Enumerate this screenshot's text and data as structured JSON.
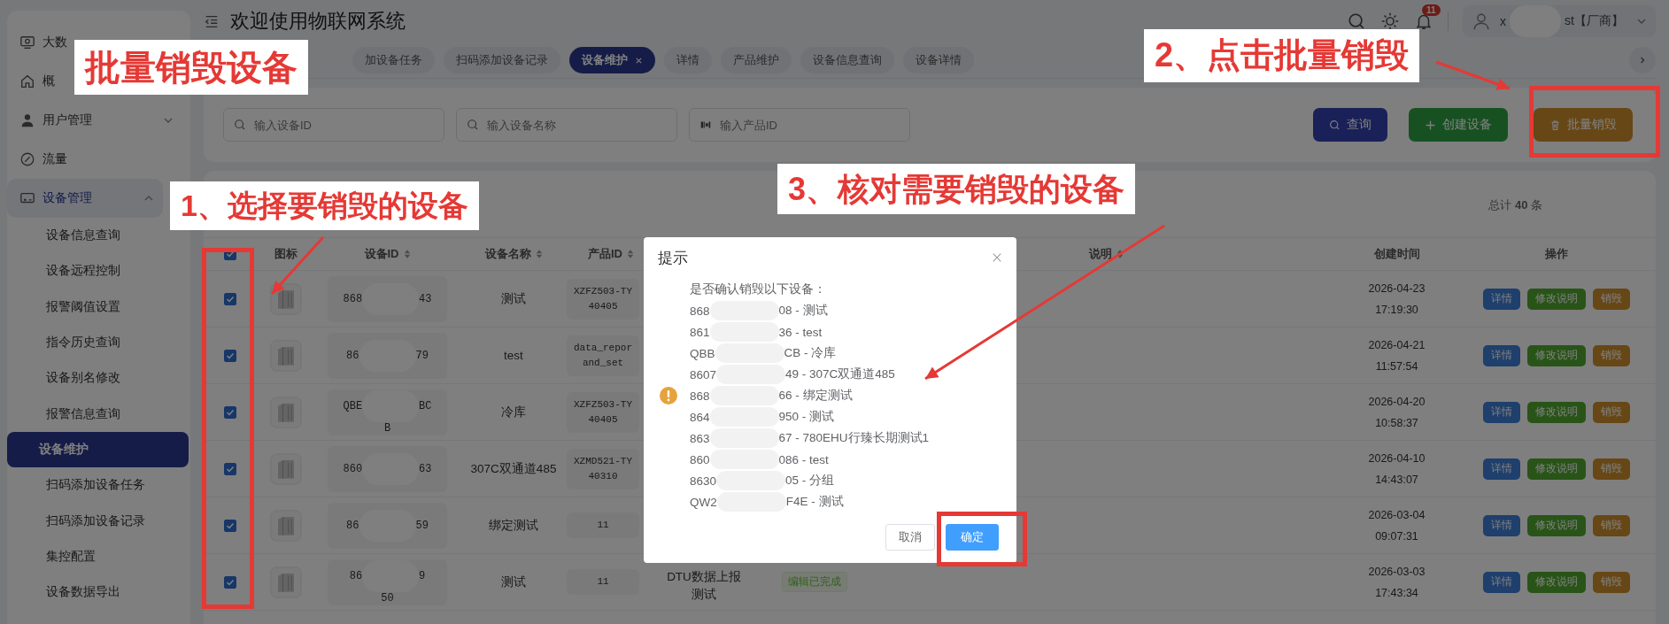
{
  "annotations": {
    "callouts": [
      {
        "text": "批量销毁设备"
      },
      {
        "text": "1、选择要销毁的设备"
      },
      {
        "text": "2、点击批量销毁"
      },
      {
        "text": "3、核对需要销毁的设备"
      }
    ]
  },
  "sidebar": {
    "items": [
      {
        "label": "大数"
      },
      {
        "label": "概"
      },
      {
        "label": "用户管理",
        "expanded": false
      },
      {
        "label": "流量"
      },
      {
        "label": "设备管理",
        "expanded": true,
        "children": [
          {
            "label": "设备信息查询",
            "selected": false
          },
          {
            "label": "设备远程控制",
            "selected": false
          },
          {
            "label": "报警阈值设置",
            "selected": false
          },
          {
            "label": "指令历史查询",
            "selected": false
          },
          {
            "label": "设备别名修改",
            "selected": false
          },
          {
            "label": "报警信息查询",
            "selected": false
          },
          {
            "label": "设备维护",
            "selected": true
          },
          {
            "label": "扫码添加设备任务",
            "selected": false
          },
          {
            "label": "扫码添加设备记录",
            "selected": false
          },
          {
            "label": "集控配置",
            "selected": false
          },
          {
            "label": "设备数据导出",
            "selected": false
          }
        ]
      }
    ]
  },
  "header": {
    "title": "欢迎使用物联网系统",
    "notification_count": "11",
    "user": {
      "name_head": "x",
      "name_tail": "st【厂商】"
    }
  },
  "tabs": [
    {
      "label": "加设备任务",
      "selected": false
    },
    {
      "label": "扫码添加设备记录",
      "selected": false
    },
    {
      "label": "设备维护",
      "selected": true
    },
    {
      "label": "详情",
      "selected": false
    },
    {
      "label": "产品维护",
      "selected": false
    },
    {
      "label": "设备信息查询",
      "selected": false
    },
    {
      "label": "设备详情",
      "selected": false
    }
  ],
  "filters": {
    "fields": [
      {
        "placeholder": "输入设备ID"
      },
      {
        "placeholder": "输入设备名称"
      },
      {
        "placeholder": "输入产品ID"
      }
    ],
    "buttons": [
      {
        "label": "查询",
        "kind": "search"
      },
      {
        "label": "创建设备",
        "kind": "create"
      },
      {
        "label": "批量销毁",
        "kind": "delete"
      }
    ]
  },
  "table": {
    "total": "总计 **40** 条",
    "all_checked": true,
    "columns": [
      {
        "label": "图标",
        "sortable": false
      },
      {
        "label": "设备ID",
        "sortable": true
      },
      {
        "label": "设备名称",
        "sortable": true
      },
      {
        "label": "产品ID",
        "sortable": true
      },
      {
        "label": "说明",
        "sortable": true
      },
      {
        "label": "创建时间",
        "sortable": false
      },
      {
        "label": "操作",
        "sortable": false
      }
    ],
    "rows": [
      {
        "checked": true,
        "device_id": {
          "head": "868",
          "tail": "43"
        },
        "name": "测试",
        "product_id": [
          "XZFZ503-TY",
          "40405"
        ],
        "created": [
          "2026-04-23",
          "17:19:30"
        ],
        "actions": [
          "详情",
          "修改说明",
          "销毁"
        ]
      },
      {
        "checked": true,
        "device_id": {
          "head": "86",
          "tail": "79"
        },
        "name": "test",
        "product_id": [
          "data_repor",
          "and_set"
        ],
        "created": [
          "2026-04-21",
          "11:57:54"
        ],
        "actions": [
          "详情",
          "修改说明",
          "销毁"
        ]
      },
      {
        "checked": true,
        "device_id": {
          "head": "QBE",
          "tail": "BC",
          "line_2": "B"
        },
        "name": "冷库",
        "product_id": [
          "XZFZ503-TY",
          "40405"
        ],
        "created": [
          "2026-04-20",
          "10:58:37"
        ],
        "actions": [
          "详情",
          "修改说明",
          "销毁"
        ]
      },
      {
        "checked": true,
        "device_id": {
          "head": "860",
          "tail": "63"
        },
        "name": "307C双通道485",
        "product_id": [
          "XZMD521-TY",
          "40310"
        ],
        "created": [
          "2026-04-10",
          "14:43:07"
        ],
        "actions": [
          "详情",
          "修改说明",
          "销毁"
        ]
      },
      {
        "checked": true,
        "device_id": {
          "head": "86",
          "tail": "59"
        },
        "name": "绑定测试",
        "product_id": [
          "11"
        ],
        "created": [
          "2026-03-04",
          "09:07:31"
        ],
        "actions": [
          "详情",
          "修改说明",
          "销毁"
        ]
      },
      {
        "checked": true,
        "device_id": {
          "head": "86",
          "tail": "9",
          "line_2": "50"
        },
        "name": "测试",
        "product_id": [
          "11"
        ],
        "column_6": [
          "DTU数据上报",
          "测试"
        ],
        "column_7": "编辑已完成",
        "created": [
          "2026-03-03",
          "17:43:34"
        ],
        "actions": [
          "详情",
          "修改说明",
          "销毁"
        ]
      }
    ]
  },
  "dialog": {
    "title": "提示",
    "message": "是否确认销毁以下设备：",
    "items": [
      {
        "head": "868",
        "tail": "08 - 测试"
      },
      {
        "head": "861",
        "tail": "36 - test"
      },
      {
        "head": "QBB",
        "tail": "CB - 冷库"
      },
      {
        "head": "8607",
        "tail": "49 - 307C双通道485"
      },
      {
        "head": "868",
        "tail": "66 - 绑定测试"
      },
      {
        "head": "864",
        "tail": "950 - 测试"
      },
      {
        "head": "863",
        "tail": "67 - 780EHU行臻长期测试1"
      },
      {
        "head": "860",
        "tail": "086 - test"
      },
      {
        "head": "8630",
        "tail": "05 - 分组"
      },
      {
        "head": "QW2",
        "tail": "F4E - 测试"
      }
    ],
    "buttons": [
      {
        "label": "取消",
        "kind": "cancel"
      },
      {
        "label": "确定",
        "kind": "primary"
      }
    ]
  }
}
